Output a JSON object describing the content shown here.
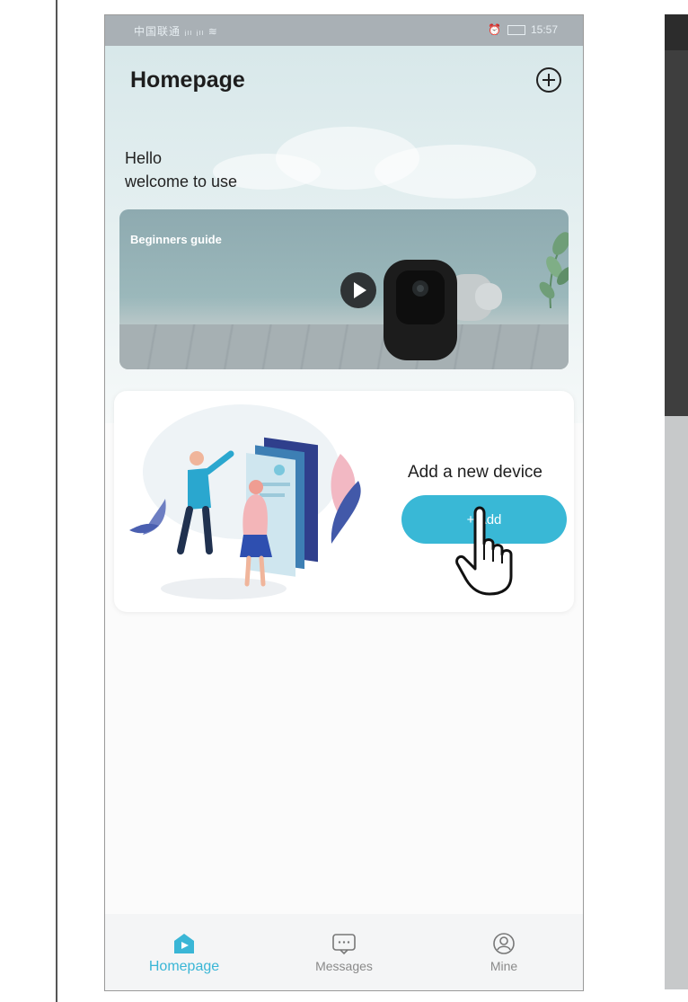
{
  "status_bar": {
    "left_text": "中国联通 ᵢₗₗ ᵢₗₗ ≋",
    "time": "15:57",
    "right_icons": "alarm-icon battery-icon"
  },
  "header": {
    "title": "Homepage",
    "add_icon": "plus-circle-icon"
  },
  "greeting": {
    "line1": "Hello",
    "line2": "welcome to use"
  },
  "guide_card": {
    "label": "Beginners guide",
    "play_icon": "play-icon"
  },
  "device_card": {
    "title": "Add a new device",
    "button_label": "+ Add",
    "cursor_icon": "hand-pointer-icon"
  },
  "tab_bar": {
    "tabs": [
      {
        "label": "Homepage",
        "icon": "home-icon",
        "active": true
      },
      {
        "label": "Messages",
        "icon": "message-icon",
        "active": false
      },
      {
        "label": "Mine",
        "icon": "user-icon",
        "active": false
      }
    ]
  },
  "colors": {
    "accent": "#3ab6d6",
    "status_bar": "#a9b0b5",
    "hero_bg": "#dbe9eb"
  }
}
